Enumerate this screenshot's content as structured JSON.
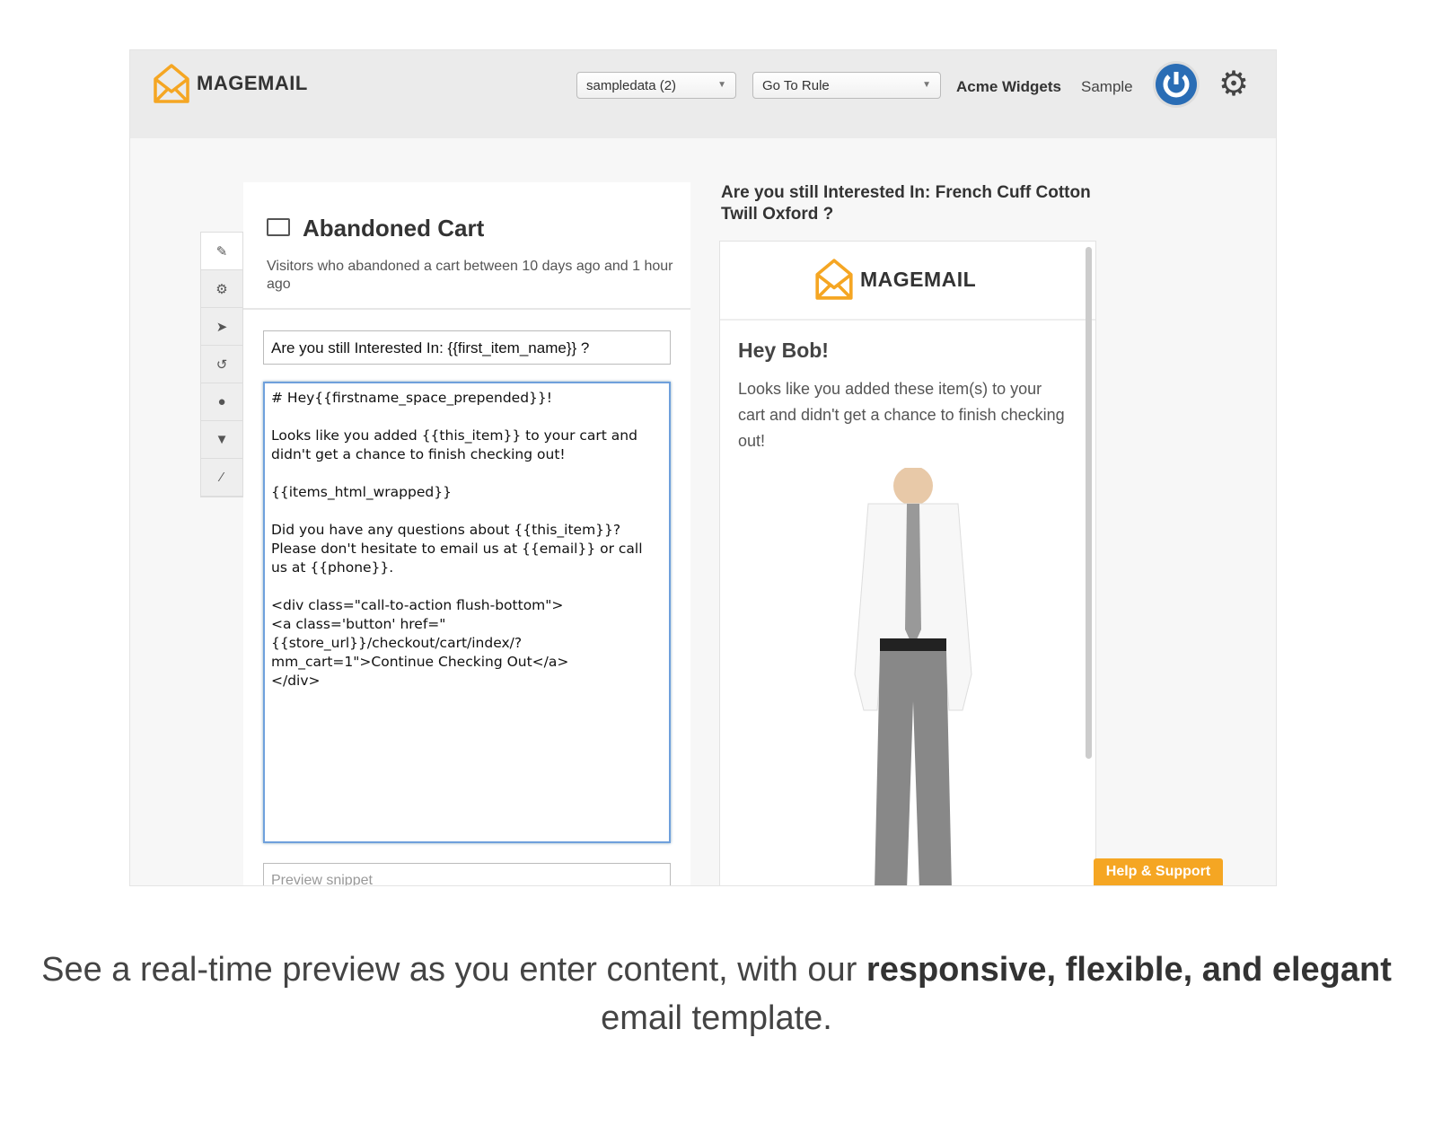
{
  "header": {
    "brand": "MAGEMAIL",
    "store_select": "sampledata (2)",
    "rule_select": "Go To Rule",
    "store_name": "Acme Widgets",
    "user": "Sample"
  },
  "sidebar": {
    "icons": [
      "edit-icon",
      "gear-icon",
      "send-icon",
      "history-icon",
      "user-icon",
      "filter-icon",
      "magic-wand-icon"
    ]
  },
  "editor": {
    "title": "Abandoned Cart",
    "description": "Visitors who abandoned a cart between 10 days ago and 1 hour ago",
    "subject": "Are you still Interested In: {{first_item_name}} ?",
    "body": "# Hey{{firstname_space_prepended}}!\n\nLooks like you added {{this_item}} to your cart and didn't get a chance to finish checking out!\n\n{{items_html_wrapped}}\n\nDid you have any questions about {{this_item}}? Please don't hesitate to email us at {{email}} or call us at {{phone}}.\n\n<div class=\"call-to-action flush-bottom\">\n<a class='button' href=\"{{store_url}}/checkout/cart/index/?mm_cart=1\">Continue Checking Out</a>\n</div>",
    "snippet_placeholder": "Preview snippet"
  },
  "preview": {
    "subject": "Are you still Interested In: French Cuff Cotton Twill Oxford ?",
    "brand": "MAGEMAIL",
    "greeting": "Hey Bob!",
    "text": "Looks like you added these item(s) to your cart and didn't get a chance to finish checking out!"
  },
  "help_label": "Help & Support",
  "caption": {
    "part1": "See a real-time preview as you enter content, with our ",
    "bold1": "responsive, flexible, and elegant",
    "part2": " email template."
  },
  "colors": {
    "brand_orange": "#f5a623",
    "power_blue": "#2a6db5",
    "focus_blue": "#6fa0dc"
  }
}
